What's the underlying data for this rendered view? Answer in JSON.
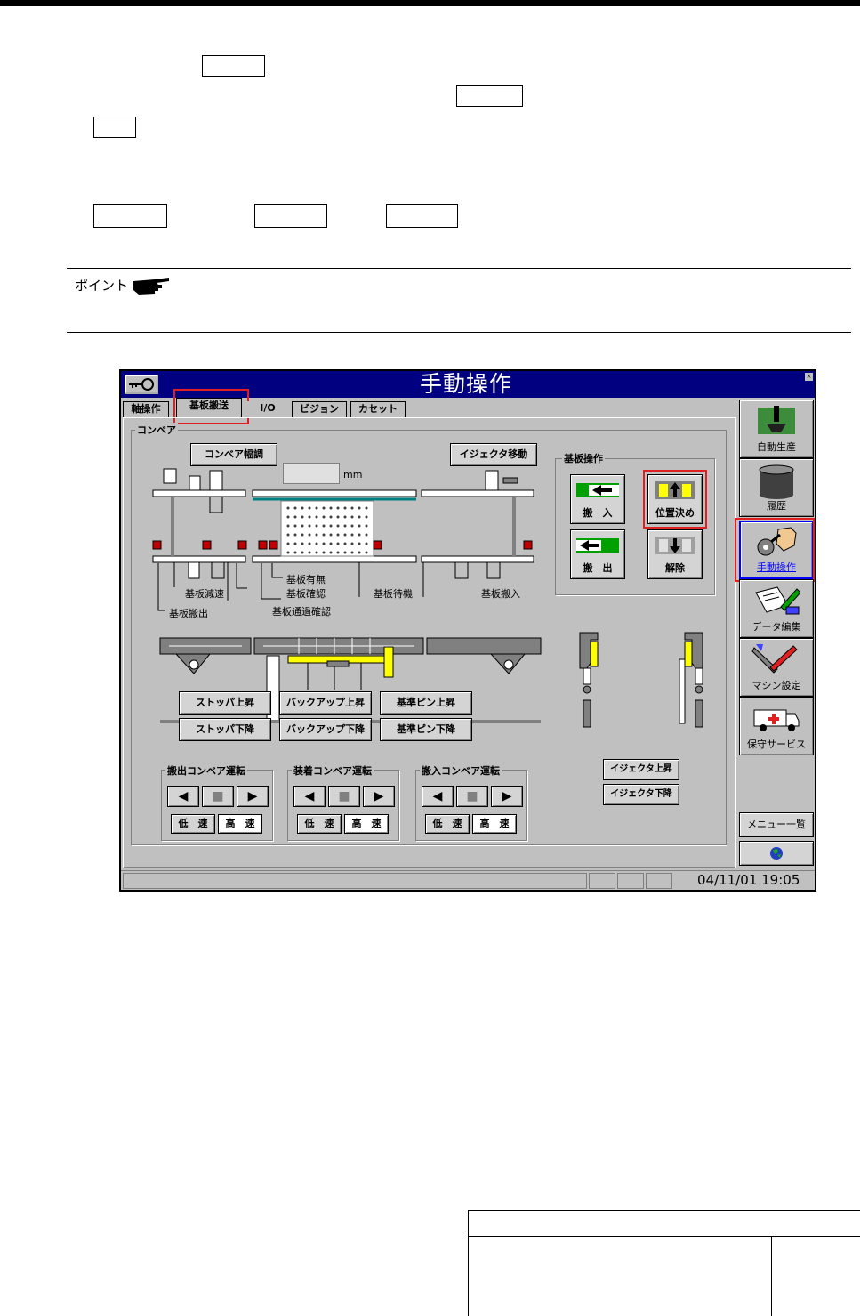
{
  "doc": {
    "point_label": "ポイント"
  },
  "window": {
    "title": "手動操作",
    "close_glyph": "×",
    "tabs": [
      "軸操作",
      "基板搬送",
      "I/O",
      "ビジョン",
      "カセット"
    ],
    "group_conveyor": "コンベア",
    "buttons": {
      "conveyor_width": "コンベア幅調",
      "ejector_move": "イジェクタ移動",
      "stopper_up": "ストッパ上昇",
      "stopper_down": "ストッパ下降",
      "backup_up": "バックアップ上昇",
      "backup_down": "バックアップ下降",
      "refpin_up": "基準ピン上昇",
      "refpin_down": "基準ピン下降",
      "ejector_up": "イジェクタ上昇",
      "ejector_down": "イジェクタ下降"
    },
    "unit_mm": "mm",
    "board_ops": {
      "label": "基板操作",
      "carry_in": "搬　入",
      "positioning": "位置決め",
      "carry_out": "搬　出",
      "release": "解除"
    },
    "sensor_labels": {
      "board_present": "基板有無",
      "board_check": "基板確認",
      "decel": "基板減速",
      "wait": "基板待機",
      "load": "基板搬入",
      "pass_check": "基板通過確認",
      "unload": "基板搬出"
    },
    "conveyor_groups": [
      {
        "label": "搬出コンベア運転"
      },
      {
        "label": "装着コンベア運転"
      },
      {
        "label": "搬入コンベア運転"
      }
    ],
    "transport": {
      "left": "◀",
      "stop": "■",
      "right": "▶"
    },
    "speed": {
      "low": "低　速",
      "high": "高　速"
    },
    "sidebar": [
      {
        "label": "自動生産"
      },
      {
        "label": "履歴"
      },
      {
        "label": "手動操作"
      },
      {
        "label": "データ編集"
      },
      {
        "label": "マシン設定"
      },
      {
        "label": "保守サービス"
      }
    ],
    "menu_list": "メニュー一覧",
    "status_time": "04/11/01 19:05"
  },
  "colors": {
    "title_bar": "#000080",
    "highlight": "#e02020",
    "active_side": "#0000ff",
    "cylinder_yellow": "#ffff00"
  }
}
